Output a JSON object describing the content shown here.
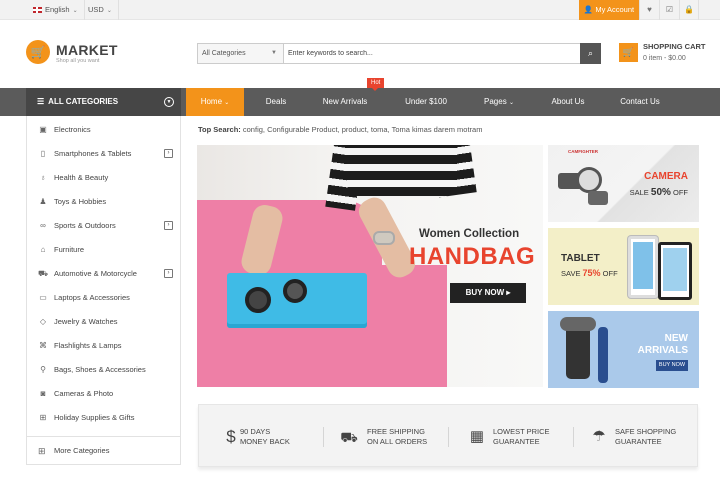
{
  "topbar": {
    "language": "English",
    "currency": "USD",
    "account": "My Account",
    "icons": [
      "heart-icon",
      "checklist-icon",
      "lock-icon"
    ]
  },
  "logo": {
    "title": "MARKET",
    "tagline": "Shop all you want"
  },
  "search": {
    "category": "All Categories",
    "placeholder": "Enter keywords to search..."
  },
  "cart": {
    "title": "SHOPPING CART",
    "summary": "0 item - $0.00"
  },
  "nav": {
    "all_categories": "ALL CATEGORIES",
    "items": [
      {
        "label": "Home",
        "dropdown": true
      },
      {
        "label": "Deals"
      },
      {
        "label": "New Arrivals",
        "badge": "Hot"
      },
      {
        "label": "Under $100"
      },
      {
        "label": "Pages",
        "dropdown": true
      },
      {
        "label": "About Us"
      },
      {
        "label": "Contact Us"
      }
    ],
    "colors": {
      "accent": "#f3931a",
      "nav_bg": "#5b5b5b",
      "hot": "#e8442e"
    }
  },
  "categories": [
    {
      "label": "Electronics",
      "icon": "monitor-icon"
    },
    {
      "label": "Smartphones & Tablets",
      "icon": "tablet-icon",
      "sub": true
    },
    {
      "label": "Health & Beauty",
      "icon": "bottle-icon"
    },
    {
      "label": "Toys & Hobbies",
      "icon": "toy-icon"
    },
    {
      "label": "Sports & Outdoors",
      "icon": "bike-icon",
      "sub": true
    },
    {
      "label": "Furniture",
      "icon": "furniture-icon"
    },
    {
      "label": "Automotive & Motorcycle",
      "icon": "car-icon",
      "sub": true
    },
    {
      "label": "Laptops & Accessories",
      "icon": "laptop-icon"
    },
    {
      "label": "Jewelry & Watches",
      "icon": "diamond-icon"
    },
    {
      "label": "Flashlights & Lamps",
      "icon": "flashlight-icon"
    },
    {
      "label": "Bags, Shoes & Accessories",
      "icon": "bag-icon"
    },
    {
      "label": "Cameras & Photo",
      "icon": "camera-icon"
    },
    {
      "label": "Holiday Supplies & Gifts",
      "icon": "gift-icon"
    }
  ],
  "more_categories": "More Categories",
  "top_search": {
    "label": "Top Search:",
    "terms": "config,  Configurable Product,  product,  toma,  Toma kimas darem motram"
  },
  "hero": {
    "subtitle": "Women Collection",
    "title": "HANDBAG",
    "button": "BUY NOW"
  },
  "banners": {
    "camera": {
      "brand": "CAMFIGHTER",
      "title": "CAMERA",
      "sale_prefix": "SALE",
      "sale_value": "50%",
      "sale_suffix": "OFF"
    },
    "tablet": {
      "title": "TABLET",
      "sale_prefix": "SAVE",
      "sale_value": "75%",
      "sale_suffix": "OFF"
    },
    "arrivals": {
      "title_line1": "NEW",
      "title_line2": "ARRIVALS",
      "button": "BUY NOW"
    }
  },
  "features": [
    {
      "line1": "90 DAYS",
      "line2": "MONEY BACK",
      "icon": "dollar-icon"
    },
    {
      "line1": "FREE SHIPPING",
      "line2": "ON ALL ORDERS",
      "icon": "truck-icon"
    },
    {
      "line1": "LOWEST PRICE",
      "line2": "GUARANTEE",
      "icon": "calendar-icon"
    },
    {
      "line1": "SAFE SHOPPING",
      "line2": "GUARANTEE",
      "icon": "umbrella-icon"
    }
  ]
}
